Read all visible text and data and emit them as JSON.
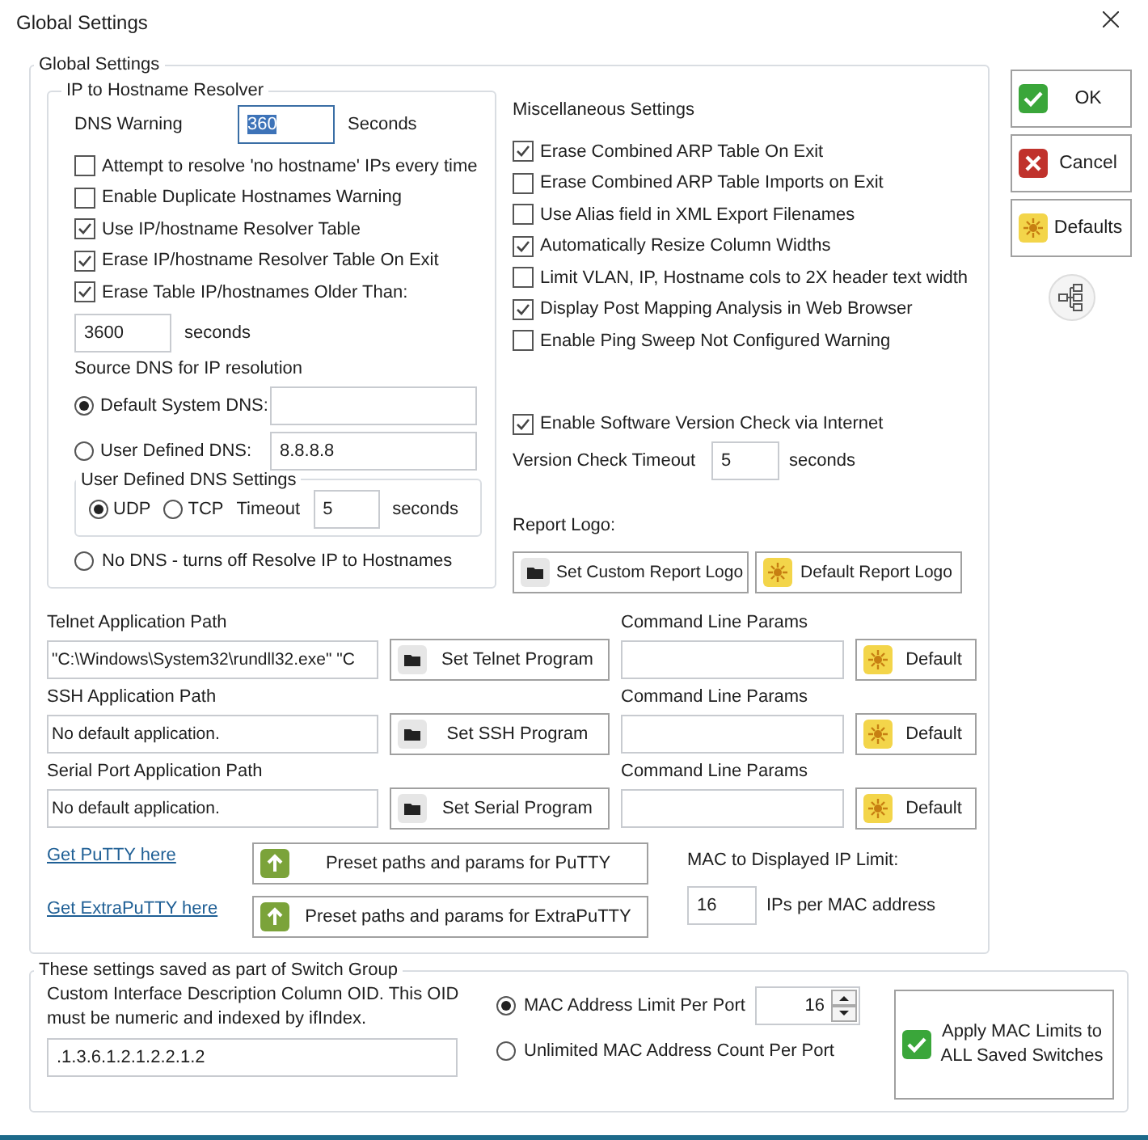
{
  "window": {
    "title": "Global Settings"
  },
  "global_settings": {
    "title": "Global Settings",
    "resolver": {
      "title": "IP to Hostname Resolver",
      "dns_warning": {
        "label": "DNS Warning",
        "value": "360",
        "selected": true,
        "unit": "Seconds"
      },
      "options": [
        {
          "label": "Attempt to resolve 'no hostname' IPs every time",
          "checked": false
        },
        {
          "label": "Enable Duplicate Hostnames Warning",
          "checked": false
        },
        {
          "label": "Use IP/hostname Resolver Table",
          "checked": true
        },
        {
          "label": "Erase IP/hostname Resolver Table On Exit",
          "checked": true
        },
        {
          "label": "Erase Table IP/hostnames Older Than:",
          "checked": true
        }
      ],
      "older_than": {
        "value": "3600",
        "unit": "seconds"
      },
      "source_label": "Source DNS for IP resolution",
      "sources": [
        {
          "kind": "field",
          "label": "Default System DNS:",
          "selected": true
        },
        {
          "kind": "field",
          "label": "User Defined DNS:",
          "selected": false,
          "value": "8.8.8.8"
        },
        {
          "kind": "plain",
          "label": "No DNS - turns off Resolve IP to Hostnames",
          "selected": false
        }
      ],
      "dns_settings": {
        "title": "User Defined DNS Settings",
        "protocols": [
          {
            "label": "UDP",
            "selected": true
          },
          {
            "label": "TCP",
            "selected": false
          }
        ],
        "timeout": {
          "label": "Timeout",
          "value": "5",
          "unit": "seconds"
        }
      }
    },
    "misc": {
      "title": "Miscellaneous Settings",
      "options": [
        {
          "label": "Erase Combined ARP Table On Exit",
          "checked": true
        },
        {
          "label": "Erase Combined ARP Table Imports on Exit",
          "checked": false
        },
        {
          "label": "Use Alias field in XML Export Filenames",
          "checked": false
        },
        {
          "label": "Automatically Resize Column Widths",
          "checked": true
        },
        {
          "label": "Limit VLAN, IP, Hostname cols to 2X header text width",
          "checked": false
        },
        {
          "label": "Display Post Mapping Analysis in Web Browser",
          "checked": true
        },
        {
          "label": "Enable Ping Sweep Not Configured Warning",
          "checked": false
        }
      ],
      "version_check": {
        "label": "Enable Software Version Check via Internet",
        "checked": true
      },
      "timeout": {
        "label": "Version Check Timeout",
        "value": "5",
        "unit": "seconds"
      },
      "report_logo": {
        "label": "Report Logo:",
        "buttons": [
          {
            "label": "Set Custom Report Logo",
            "kind": "folder"
          },
          {
            "label": "Default Report Logo",
            "kind": "reset"
          }
        ]
      }
    },
    "applications": [
      {
        "label": "Telnet Application Path",
        "value": "\"C:\\Windows\\System32\\rundll32.exe\" \"C",
        "button": "Set Telnet Program",
        "params_label": "Command Line Params",
        "default_button": "Default"
      },
      {
        "label": "SSH Application Path",
        "value": "No default application.",
        "button": "Set SSH Program",
        "params_label": "Command Line Params",
        "default_button": "Default"
      },
      {
        "label": "Serial Port Application Path",
        "value": "No default application.",
        "button": "Set Serial Program",
        "params_label": "Command Line Params",
        "default_button": "Default"
      }
    ],
    "putty": [
      {
        "link": "Get PuTTY here",
        "button": "Preset paths and params for PuTTY"
      },
      {
        "link": "Get ExtraPuTTY here",
        "button": "Preset paths and params for ExtraPuTTY"
      }
    ],
    "mac_limit": {
      "label": "MAC to Displayed IP Limit:",
      "value": "16",
      "unit": "IPs per MAC address"
    }
  },
  "side_buttons": [
    {
      "label": "OK",
      "kind": "ok"
    },
    {
      "label": "Cancel",
      "kind": "cancel"
    },
    {
      "label": "Defaults",
      "kind": "reset"
    }
  ],
  "switch_group": {
    "title": "These settings saved as part of Switch Group",
    "oid_label": "Custom Interface Description Column OID. This OID must be numeric and indexed by ifIndex.",
    "oid_value": ".1.3.6.1.2.1.2.2.1.2",
    "mac_options": [
      {
        "label": "MAC Address Limit Per Port",
        "selected": true,
        "value": "16"
      },
      {
        "label": "Unlimited MAC Address Count Per Port",
        "selected": false
      }
    ],
    "apply": {
      "label": "Apply MAC Limits to ALL Saved Switches",
      "checked": true
    }
  }
}
